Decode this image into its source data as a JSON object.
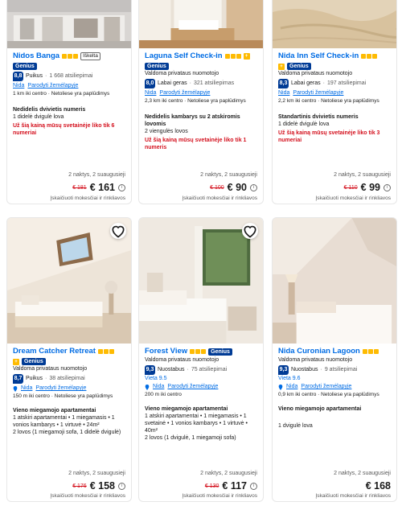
{
  "cards": [
    {
      "name": "Nidos Banga",
      "stars": 3,
      "badge": "Iškelta",
      "genius": "Genius",
      "score": "8,8",
      "score_word": "Puikus",
      "reviews": "1 668 atsiliepimai",
      "location": "Nida",
      "map_link": "Parodyti žemėlapyje",
      "distance": "1 km iki centro",
      "beach": "Netoliese yra paplūdimys",
      "room_title": "Nedidelis dvivietis numeris",
      "room_lines": [
        "1 didelė dvigulė lova"
      ],
      "urgency": "Už šią kainą mūsų svetainėje liko tik 6 numeriai",
      "nights": "2 naktys, 2 suaugusieji",
      "old_price": "€ 181",
      "price": "€ 161",
      "taxes": "Įskaičiuoti mokesčiai ir rinkliavos"
    },
    {
      "name": "Laguna Self Check-in",
      "stars": 3,
      "genius": "Genius",
      "property_type": "Valdoma privataus nuomotojo",
      "score": "8,0",
      "score_word": "Labai geras",
      "reviews": "321 atsiliepimas",
      "location": "Nida",
      "map_link": "Parodyti žemėlapyje",
      "distance": "2,3 km iki centro",
      "beach": "Netoliese yra paplūdimys",
      "room_title": "Nedidelis kambarys su 2 atskiromis lovomis",
      "room_lines": [
        "2 viengulės lovos"
      ],
      "urgency": "Už šią kainą mūsų svetainėje liko tik 1 numeris",
      "nights": "2 naktys, 2 suaugusieji",
      "old_price": "€ 100",
      "price": "€ 90",
      "taxes": "Įskaičiuoti mokesčiai ir rinkliavos"
    },
    {
      "name": "Nida Inn Self Check-in",
      "stars": 3,
      "genius": "Genius",
      "property_type": "Valdoma privataus nuomotojo",
      "score": "8,3",
      "score_word": "Labai geras",
      "reviews": "197 atsiliepimai",
      "location": "Nida",
      "map_link": "Parodyti žemėlapyje",
      "distance": "2,2 km iki centro",
      "beach": "Netoliese yra paplūdimys",
      "room_title": "Standartinis dvivietis numeris",
      "room_lines": [
        "1 didelė dvigulė lova"
      ],
      "urgency": "Už šią kainą mūsų svetainėje liko tik 3 numeriai",
      "nights": "2 naktys, 2 suaugusieji",
      "old_price": "€ 110",
      "price": "€ 99",
      "taxes": "Įskaičiuoti mokesčiai ir rinkliavos"
    },
    {
      "name": "Dream Catcher Retreat",
      "stars": 3,
      "genius": "Genius",
      "property_type": "Valdoma privataus nuomotojo",
      "score": "8,7",
      "score_word": "Puikus",
      "reviews": "38 atsiliepimai",
      "location": "Nida",
      "map_link": "Parodyti žemėlapyje",
      "distance": "150 m iki centro",
      "beach": "Netoliese yra paplūdimys",
      "room_title": "Vieno miegamojo apartamentai",
      "room_lines": [
        "1 atskiri apartamentai • 1 miegamasis • 1 vonios kambarys • 1 virtuvė • 24m²",
        "2 lovos (1 miegamoji sofa, 1 didelė dvigulė)"
      ],
      "nights": "2 naktys, 2 suaugusieji",
      "old_price": "€ 176",
      "price": "€ 158",
      "taxes": "Įskaičiuoti mokesčiai ir rinkliavos"
    },
    {
      "name": "Forest View",
      "stars": 3,
      "genius": "Genius",
      "property_type": "Valdoma privataus nuomotojo",
      "score": "9,3",
      "score_word": "Nuostabus",
      "reviews": "75 atsiliepimai",
      "vieta": "Vieta 9.5",
      "location": "Nida",
      "map_link": "Parodyti žemėlapyje",
      "distance": "200 m iki centro",
      "room_title": "Vieno miegamojo apartamentai",
      "room_lines": [
        "1 atskiri apartamentai • 1 miegamasis • 1 svetainė • 1 vonios kambarys • 1 virtuvė • 40m²",
        "2 lovos (1 dvigulė, 1 miegamoji sofa)"
      ],
      "nights": "2 naktys, 2 suaugusieji",
      "old_price": "€ 130",
      "price": "€ 117",
      "taxes": "Įskaičiuoti mokesčiai ir rinkliavos"
    },
    {
      "name": "Nida Curonian Lagoon",
      "stars": 3,
      "property_type": "Valdoma privataus nuomotojo",
      "score": "9,3",
      "score_word": "Nuostabus",
      "reviews": "9 atsiliepimai",
      "vieta": "Vieta 9.6",
      "location": "Nida",
      "map_link": "Parodyti žemėlapyje",
      "distance": "0,9 km iki centro",
      "beach": "Netoliese yra paplūdimys",
      "room_title": "Vieno miegamojo apartamentai",
      "room_lines": [
        "1 dvigulė lova"
      ],
      "nights": "2 naktys, 2 suaugusieji",
      "price": "€ 168",
      "taxes": "Įskaičiuoti mokesčiai ir rinkliavos"
    }
  ],
  "colors": {
    "link": "#006ce4",
    "genius": "#003b95",
    "star": "#febb02",
    "urgent": "#d4111e"
  },
  "icons": {
    "favorite": "heart-icon",
    "info": "info-icon",
    "pin": "map-pin-icon",
    "thumb": "thumbs-up-icon"
  }
}
